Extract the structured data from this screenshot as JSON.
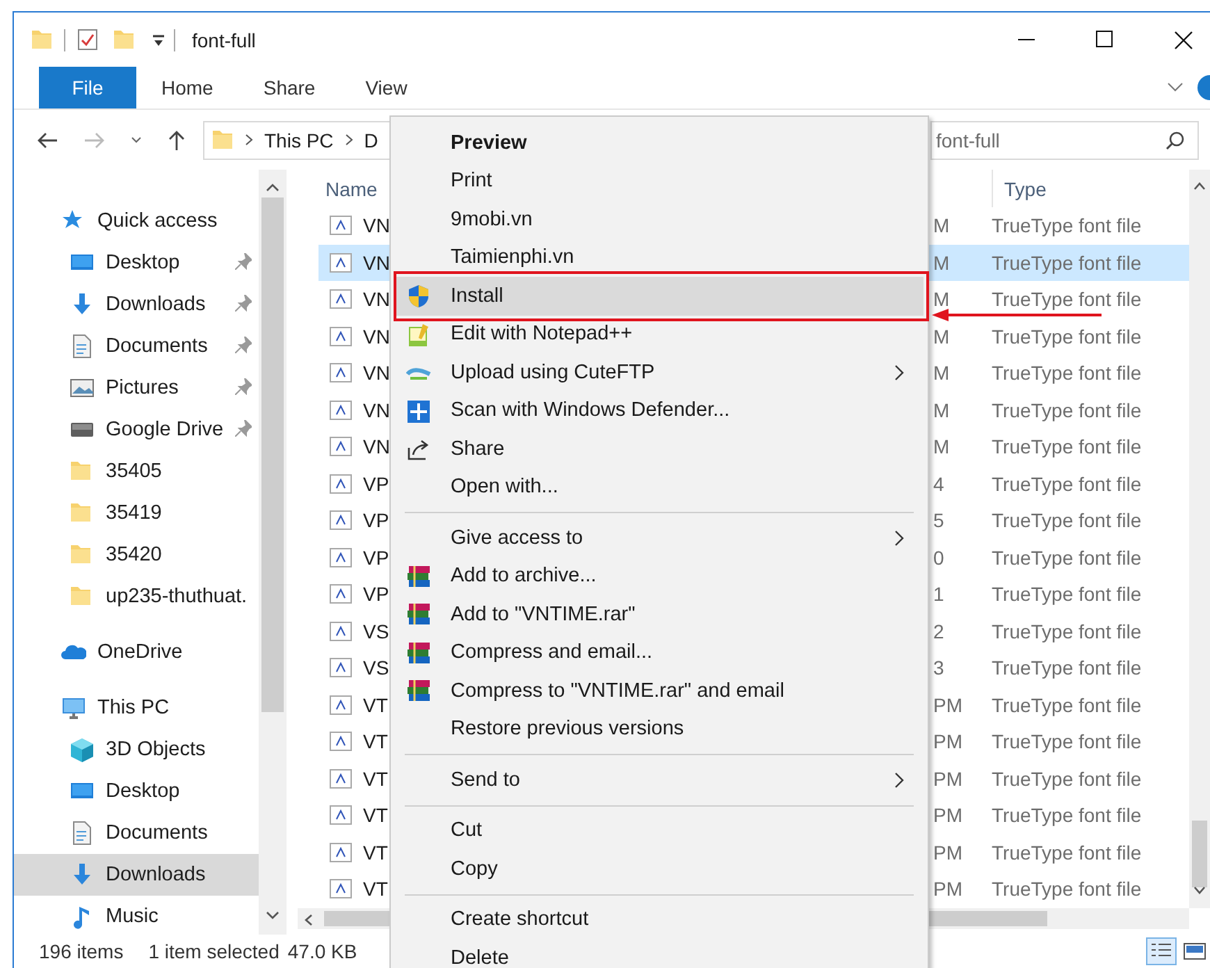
{
  "title_bar": {
    "title": "font-full"
  },
  "ribbon": {
    "tabs": [
      {
        "label": "File",
        "kind": "file"
      },
      {
        "label": "Home",
        "kind": "tab"
      },
      {
        "label": "Share",
        "kind": "tab"
      },
      {
        "label": "View",
        "kind": "tab"
      }
    ]
  },
  "address_bar": {
    "breadcrumb": [
      "This PC",
      "D"
    ],
    "search": {
      "placeholder": "font-full"
    }
  },
  "nav_pane": {
    "items": [
      {
        "label": "Quick access",
        "kind": "quick",
        "pinned": false,
        "selected": false,
        "children": [
          {
            "label": "Desktop",
            "kind": "desktop",
            "pinned": true,
            "selected": false
          },
          {
            "label": "Downloads",
            "kind": "downloads",
            "pinned": true,
            "selected": false
          },
          {
            "label": "Documents",
            "kind": "documents",
            "pinned": true,
            "selected": false
          },
          {
            "label": "Pictures",
            "kind": "pictures",
            "pinned": true,
            "selected": false
          },
          {
            "label": "Google Drive",
            "kind": "drive",
            "pinned": true,
            "selected": false
          },
          {
            "label": "35405",
            "kind": "folder",
            "pinned": false,
            "selected": false
          },
          {
            "label": "35419",
            "kind": "folder",
            "pinned": false,
            "selected": false
          },
          {
            "label": "35420",
            "kind": "folder",
            "pinned": false,
            "selected": false
          },
          {
            "label": "up235-thuthuat.",
            "kind": "folder",
            "pinned": false,
            "selected": false
          }
        ]
      },
      {
        "label": "OneDrive",
        "kind": "cloud",
        "pinned": false,
        "selected": false
      },
      {
        "label": "This PC",
        "kind": "pc",
        "pinned": false,
        "selected": false,
        "children": [
          {
            "label": "3D Objects",
            "kind": "objects3d",
            "pinned": false,
            "selected": false
          },
          {
            "label": "Desktop",
            "kind": "desktop",
            "pinned": false,
            "selected": false
          },
          {
            "label": "Documents",
            "kind": "documents",
            "pinned": false,
            "selected": false
          },
          {
            "label": "Downloads",
            "kind": "downloads",
            "pinned": false,
            "selected": true
          },
          {
            "label": "Music",
            "kind": "music",
            "pinned": false,
            "selected": false
          }
        ]
      }
    ]
  },
  "file_list": {
    "columns": [
      "Name",
      "Type"
    ],
    "rows": [
      {
        "name": "VN",
        "column_2": "M",
        "type": "TrueType font file",
        "selected": false
      },
      {
        "name": "VN",
        "column_2": "M",
        "type": "TrueType font file",
        "selected": true
      },
      {
        "name": "VN",
        "column_2": "M",
        "type": "TrueType font file",
        "selected": false
      },
      {
        "name": "VN",
        "column_2": "M",
        "type": "TrueType font file",
        "selected": false
      },
      {
        "name": "VN",
        "column_2": "M",
        "type": "TrueType font file",
        "selected": false
      },
      {
        "name": "VN",
        "column_2": "M",
        "type": "TrueType font file",
        "selected": false
      },
      {
        "name": "VN",
        "column_2": "M",
        "type": "TrueType font file",
        "selected": false
      },
      {
        "name": "VP",
        "column_2": "4",
        "type": "TrueType font file",
        "selected": false
      },
      {
        "name": "VP",
        "column_2": "5",
        "type": "TrueType font file",
        "selected": false
      },
      {
        "name": "VP",
        "column_2": "0",
        "type": "TrueType font file",
        "selected": false
      },
      {
        "name": "VP",
        "column_2": "1",
        "type": "TrueType font file",
        "selected": false
      },
      {
        "name": "VS",
        "column_2": "2",
        "type": "TrueType font file",
        "selected": false
      },
      {
        "name": "VS",
        "column_2": "3",
        "type": "TrueType font file",
        "selected": false
      },
      {
        "name": "VT",
        "column_2": "PM",
        "type": "TrueType font file",
        "selected": false
      },
      {
        "name": "VT",
        "column_2": "PM",
        "type": "TrueType font file",
        "selected": false
      },
      {
        "name": "VT",
        "column_2": "PM",
        "type": "TrueType font file",
        "selected": false
      },
      {
        "name": "VT",
        "column_2": "PM",
        "type": "TrueType font file",
        "selected": false
      },
      {
        "name": "VT",
        "column_2": "PM",
        "type": "TrueType font file",
        "selected": false
      },
      {
        "name": "VT",
        "column_2": "PM",
        "type": "TrueType font file",
        "selected": false
      }
    ]
  },
  "context_menu": {
    "items": [
      {
        "label": "Preview",
        "kind": "default",
        "submenu": false,
        "selected": false,
        "annotated": false
      },
      {
        "label": "Print",
        "kind": "plain",
        "submenu": false,
        "selected": false,
        "annotated": false
      },
      {
        "label": "9mobi.vn",
        "kind": "plain",
        "submenu": false,
        "selected": false,
        "annotated": false
      },
      {
        "label": "Taimienphi.vn",
        "kind": "plain",
        "submenu": false,
        "selected": false,
        "annotated": false
      },
      {
        "label": "Install",
        "kind": "elevated",
        "submenu": false,
        "selected": true,
        "annotated": true
      },
      {
        "label": "Edit with Notepad++",
        "kind": "notepad",
        "submenu": false,
        "selected": false,
        "annotated": false
      },
      {
        "label": "Upload using CuteFTP",
        "kind": "ftp",
        "submenu": true,
        "selected": false,
        "annotated": false
      },
      {
        "label": "Scan with Windows Defender...",
        "kind": "scan",
        "submenu": false,
        "selected": false,
        "annotated": false
      },
      {
        "label": "Share",
        "kind": "share",
        "submenu": false,
        "selected": false,
        "annotated": false
      },
      {
        "label": "Open with...",
        "kind": "plain",
        "submenu": false,
        "selected": false,
        "annotated": false
      },
      {
        "kind": "separator"
      },
      {
        "label": "Give access to",
        "kind": "plain",
        "submenu": true,
        "selected": false,
        "annotated": false
      },
      {
        "label": "Add to archive...",
        "kind": "archive",
        "submenu": false,
        "selected": false,
        "annotated": false
      },
      {
        "label": "Add to \"VNTIME.rar\"",
        "kind": "archive",
        "submenu": false,
        "selected": false,
        "annotated": false
      },
      {
        "label": "Compress and email...",
        "kind": "archive",
        "submenu": false,
        "selected": false,
        "annotated": false
      },
      {
        "label": "Compress to \"VNTIME.rar\" and email",
        "kind": "archive",
        "submenu": false,
        "selected": false,
        "annotated": false
      },
      {
        "label": "Restore previous versions",
        "kind": "plain",
        "submenu": false,
        "selected": false,
        "annotated": false
      },
      {
        "kind": "separator"
      },
      {
        "label": "Send to",
        "kind": "plain",
        "submenu": true,
        "selected": false,
        "annotated": false
      },
      {
        "kind": "separator"
      },
      {
        "label": "Cut",
        "kind": "plain",
        "submenu": false,
        "selected": false,
        "annotated": false
      },
      {
        "label": "Copy",
        "kind": "plain",
        "submenu": false,
        "selected": false,
        "annotated": false
      },
      {
        "kind": "separator"
      },
      {
        "label": "Create shortcut",
        "kind": "plain",
        "submenu": false,
        "selected": false,
        "annotated": false
      },
      {
        "label": "Delete",
        "kind": "plain",
        "submenu": false,
        "selected": false,
        "annotated": false
      }
    ]
  },
  "status_bar": {
    "item_count": "196 items",
    "selection": "1 item selected",
    "size": "47.0 KB",
    "views": [
      {
        "kind": "details",
        "selected": true
      },
      {
        "kind": "preview",
        "selected": false
      }
    ]
  }
}
